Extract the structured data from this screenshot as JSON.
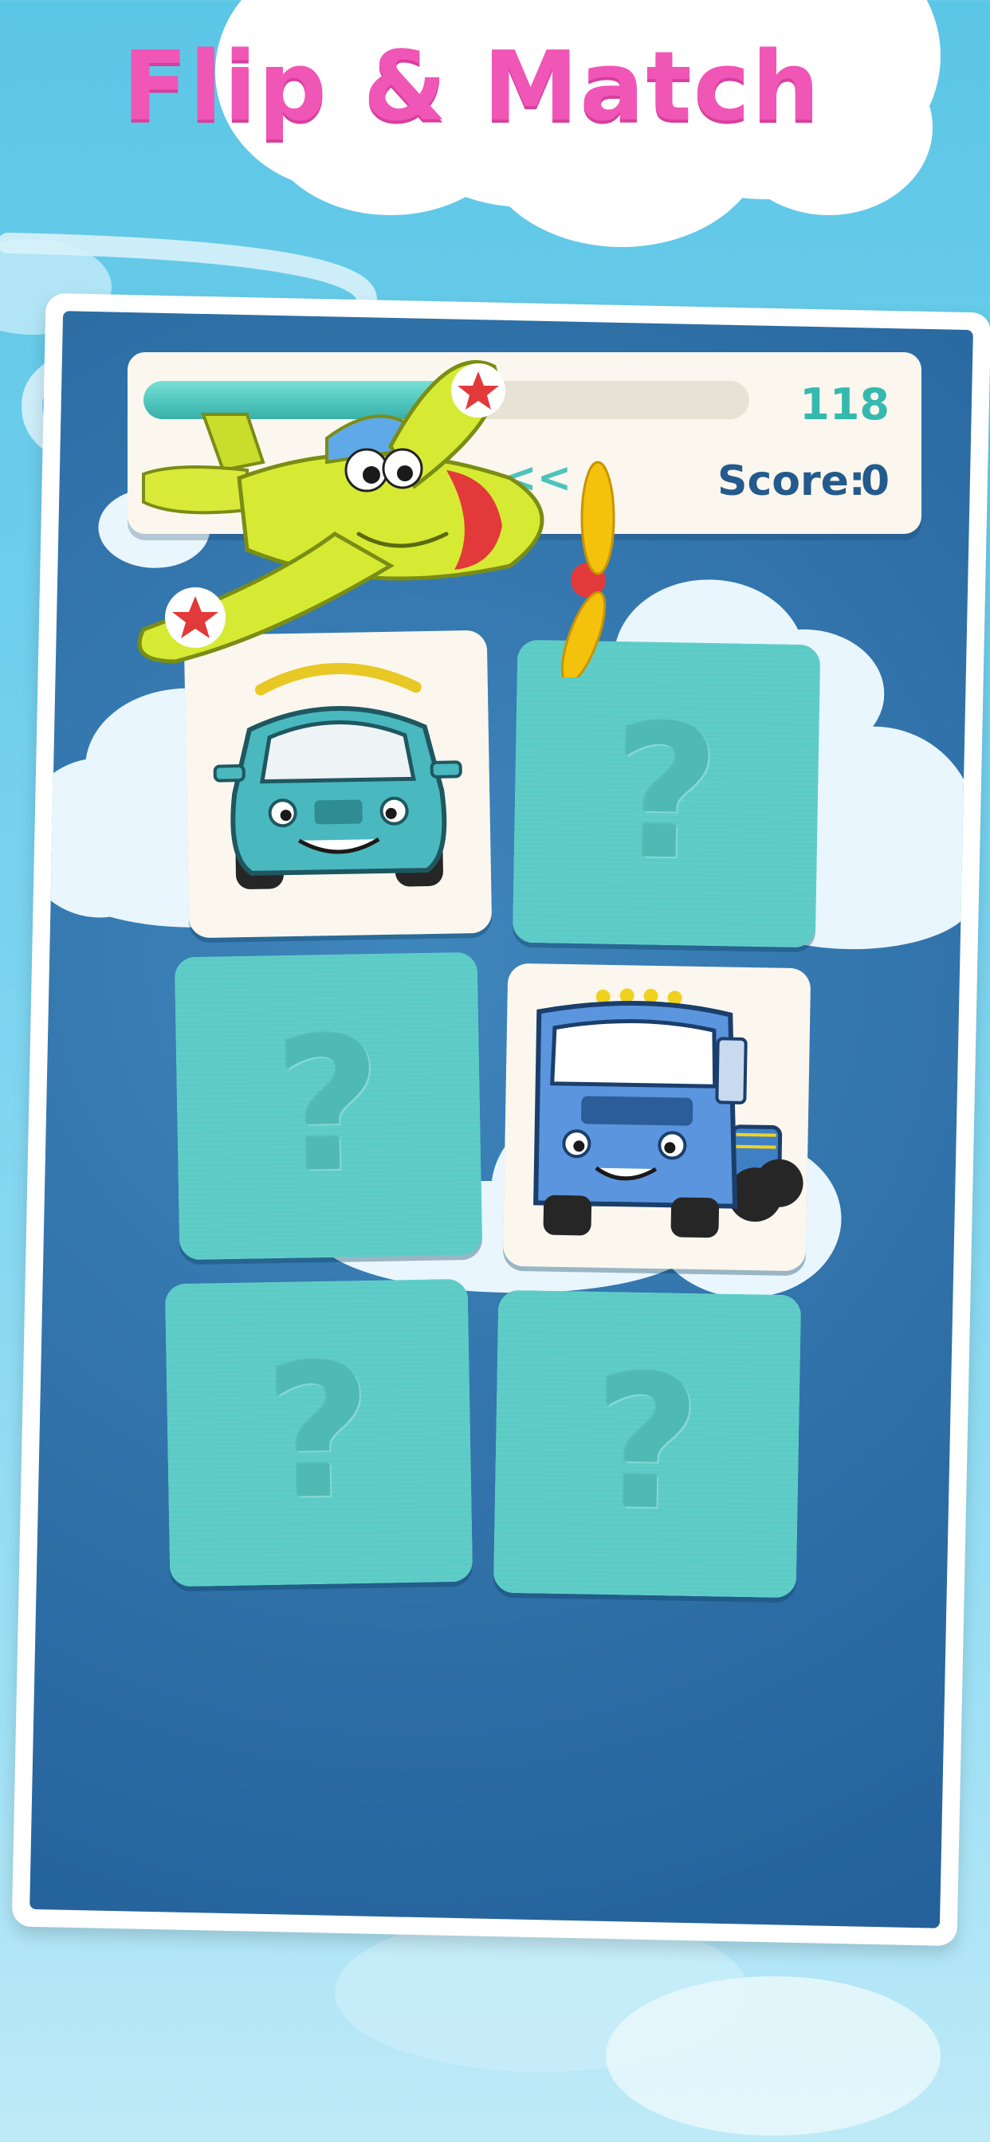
{
  "title": "Flip & Match",
  "status": {
    "timer_value": "118",
    "timer_fraction": 0.58,
    "score_label": "Score:",
    "score_value": "0",
    "back_symbol": "<<"
  },
  "cards": [
    {
      "state": "face",
      "image": "car-icon"
    },
    {
      "state": "hidden",
      "symbol": "?"
    },
    {
      "state": "hidden",
      "symbol": "?"
    },
    {
      "state": "face",
      "image": "truck-icon"
    },
    {
      "state": "hidden",
      "symbol": "?"
    },
    {
      "state": "hidden",
      "symbol": "?"
    }
  ],
  "colors": {
    "title": "#f056b6",
    "card_back": "#5ccbc6",
    "board": "#2e6fa6",
    "timer": "#4cc4bc",
    "score": "#245a8c"
  }
}
